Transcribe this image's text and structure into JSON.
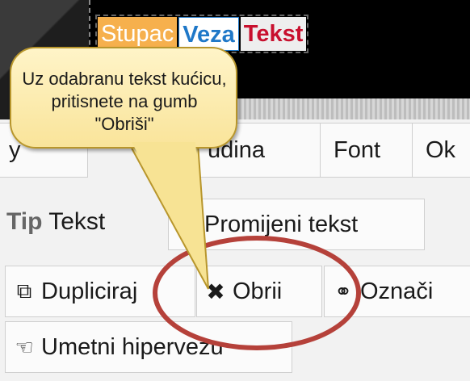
{
  "canvas": {
    "tags": [
      {
        "label": "Stupac"
      },
      {
        "label": "Veza"
      },
      {
        "label": "Tekst"
      }
    ]
  },
  "tabs": [
    {
      "label": "udina"
    },
    {
      "label": "Font"
    },
    {
      "label": "Ok"
    }
  ],
  "tip": {
    "prefix": "Tip",
    "value": "Tekst"
  },
  "buttons": {
    "change_text": "Promijeni tekst",
    "duplicate": "Dupliciraj",
    "delete": "Obrii",
    "mark": "Označi",
    "insert_link": "Umetni hipervezu"
  },
  "callout": {
    "text": "Uz odabranu tekst kućicu, pritisnete na gumb \"Obriši\""
  },
  "colors": {
    "stupac": "#f6b04d",
    "veza": "#1f78c8",
    "tekst": "#c8102e",
    "callout_fill": "#fbe9a8",
    "highlight_oval": "#b5413a"
  },
  "icons": {
    "change_text": "pencil-icon",
    "duplicate": "duplicate-icon",
    "delete": "close-icon",
    "mark": "link-icon",
    "insert_link": "hyperlink-icon"
  }
}
